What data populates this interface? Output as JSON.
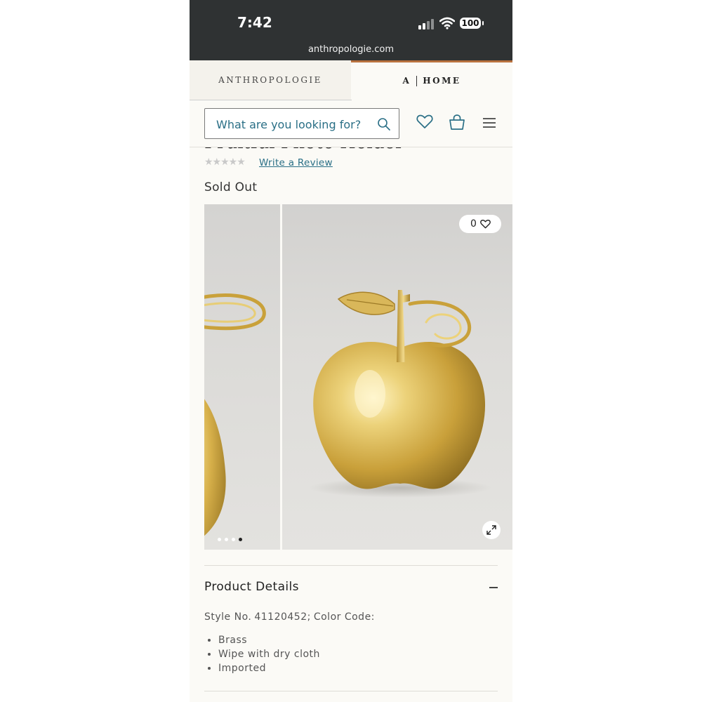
{
  "status_bar": {
    "time": "7:42",
    "battery": "100",
    "url": "anthropologie.com"
  },
  "brand_tabs": [
    {
      "label": "ANTHROPOLOGIE"
    },
    {
      "label_left": "A",
      "label_right": "HOME"
    }
  ],
  "header": {
    "search_placeholder": "What are you looking for?",
    "icons": [
      "search-icon",
      "heart-icon",
      "bag-icon",
      "menu-icon"
    ]
  },
  "product": {
    "title": "Fruitful Photo Holder",
    "rating_stars": "★★★★★",
    "review_link": "Write a Review",
    "availability": "Sold Out",
    "likes": "0",
    "carousel_active_index": 4,
    "carousel_count": 4
  },
  "details": {
    "heading": "Product Details",
    "style_label": "Style No.",
    "style_number": "41120452;",
    "color_label": "Color Code:",
    "bullets": [
      "Brass",
      "Wipe with dry cloth",
      "Imported"
    ]
  },
  "colors": {
    "status_bar_bg": "#2f3233",
    "link_teal": "#2a6f86",
    "accent_copper": "#b9723f",
    "page_bg": "#fbfaf6",
    "brass": "#d4b24a"
  }
}
